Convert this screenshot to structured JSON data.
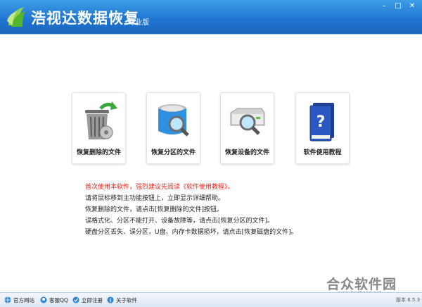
{
  "app": {
    "title": "浩视达数据恢复",
    "edition": "专业版"
  },
  "window_controls": {
    "min": "–",
    "max": "□",
    "close": "✕"
  },
  "tiles": [
    {
      "label": "恢复删除的文件",
      "icon": "recycle-bin-restore-icon"
    },
    {
      "label": "恢复分区的文件",
      "icon": "disk-search-icon"
    },
    {
      "label": "恢复设备的文件",
      "icon": "device-search-icon"
    },
    {
      "label": "软件使用教程",
      "icon": "help-book-icon"
    }
  ],
  "tips": [
    "首次使用本软件，强烈建议先阅读《软件使用教程》。",
    "请将鼠标移到主功能按钮上，立即显示详细帮助。",
    "恢复删除的文件，请点击[恢复删除的文件]按钮。",
    "误格式化、分区不能打开、设备故障等，请点击[恢复分区的文件]。",
    "硬盘分区丢失、误分区，U盘、内存卡数据损坏，请点击[恢复磁盘的文件]。"
  ],
  "bottombar": [
    {
      "label": "官方网站",
      "icon": "globe-icon"
    },
    {
      "label": "客服QQ",
      "icon": "qq-icon"
    },
    {
      "label": "立即注册",
      "icon": "register-icon"
    },
    {
      "label": "关于软件",
      "icon": "info-icon"
    }
  ],
  "watermark": {
    "brand": "合众软件园",
    "url": "www.hezhong.net"
  },
  "version": "版本 6.5.3",
  "colors": {
    "titlebar": "#1e74cf",
    "warning": "#e4281f"
  }
}
